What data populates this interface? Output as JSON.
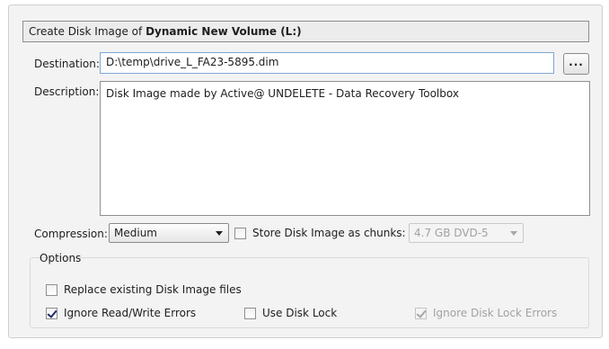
{
  "header": {
    "prefix": "Create Disk Image of ",
    "volume": "Dynamic New Volume (L:)"
  },
  "destination": {
    "label": "Destination:",
    "value": "D:\\temp\\drive_L_FA23-5895.dim",
    "browse_label": "..."
  },
  "description": {
    "label": "Description:",
    "value": "Disk Image made by Active@ UNDELETE - Data Recovery Toolbox"
  },
  "compression": {
    "label": "Compression:",
    "selected": "Medium"
  },
  "chunks": {
    "label": "Store Disk Image as chunks:",
    "checked": false,
    "size_selected": "4.7 GB DVD-5"
  },
  "options": {
    "title": "Options",
    "replace_existing": {
      "label": "Replace existing Disk Image files",
      "checked": false
    },
    "ignore_rw_errors": {
      "label": "Ignore Read/Write Errors",
      "checked": true
    },
    "use_disk_lock": {
      "label": "Use Disk Lock",
      "checked": false
    },
    "ignore_lock_errors": {
      "label": "Ignore Disk Lock Errors",
      "checked": true,
      "disabled": true
    }
  },
  "colors": {
    "panel_bg": "#f3f3f3",
    "focus_border": "#7ea6d3",
    "check_mark": "#1f2b6b"
  }
}
